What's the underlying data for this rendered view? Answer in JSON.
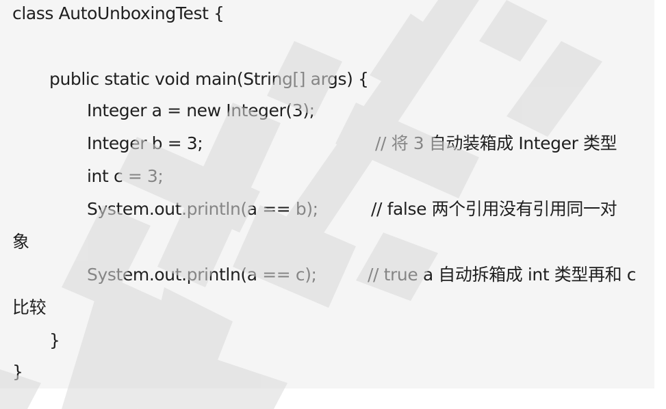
{
  "code": {
    "line1": "class AutoUnboxingTest {",
    "line2": "public static void main(String[] args) {",
    "line3": "Integer a = new Integer(3);",
    "line4": "Integer b = 3;",
    "line4_comment": "//  将 3 自动装箱成 Integer 类型",
    "line5": "int c = 3;",
    "line6": "System.out.println(a == b);",
    "line6_comment": "// false  两个引用没有引用同一对",
    "line6_wrap": "象",
    "line8": "System.out.println(a == c);",
    "line8_comment": "// true a 自动拆箱成 int 类型再和 c",
    "line8_wrap": "比较",
    "line10": "}",
    "line11": "}"
  },
  "colors": {
    "code_background": "#f5f5f5",
    "text": "#1f1f1f",
    "watermark": "#d9d9d9"
  }
}
